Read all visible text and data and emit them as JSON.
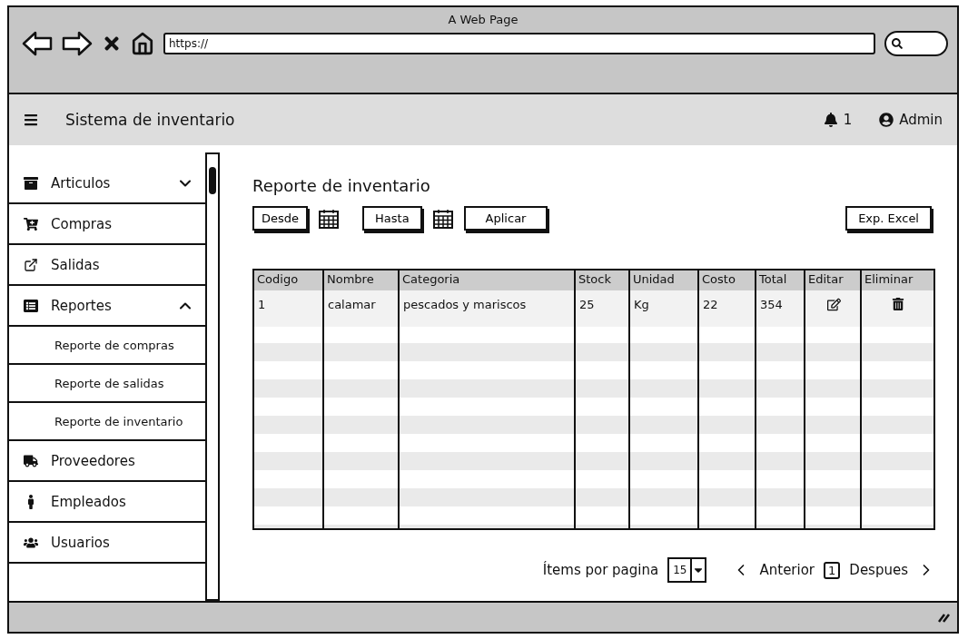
{
  "browser": {
    "title": "A Web Page",
    "url": "https://"
  },
  "header": {
    "title": "Sistema de inventario",
    "notifications": "1",
    "user": "Admin"
  },
  "sidebar": {
    "items": [
      {
        "label": "Articulos",
        "expanded": false
      },
      {
        "label": "Compras"
      },
      {
        "label": "Salidas"
      },
      {
        "label": "Reportes",
        "expanded": true,
        "children": [
          {
            "label": "Reporte de compras"
          },
          {
            "label": "Reporte de salidas"
          },
          {
            "label": "Reporte de inventario"
          }
        ]
      },
      {
        "label": "Proveedores"
      },
      {
        "label": "Empleados"
      },
      {
        "label": "Usuarios"
      }
    ]
  },
  "content": {
    "title": "Reporte de inventario",
    "from": "Desde",
    "to": "Hasta",
    "apply": "Aplicar",
    "export": "Exp. Excel",
    "table": {
      "columns": [
        "Codigo",
        "Nombre",
        "Categoria",
        "Stock",
        "Unidad",
        "Costo",
        "Total",
        "Editar",
        "Eliminar"
      ],
      "rows": [
        {
          "cells": [
            "1",
            "calamar",
            "pescados y mariscos",
            "25",
            "Kg",
            "22",
            "354"
          ]
        }
      ]
    },
    "pagination": {
      "items_label": "Ítems por pagina",
      "per_page": "15",
      "prev": "Anterior",
      "page": "1",
      "next": "Despues"
    }
  }
}
